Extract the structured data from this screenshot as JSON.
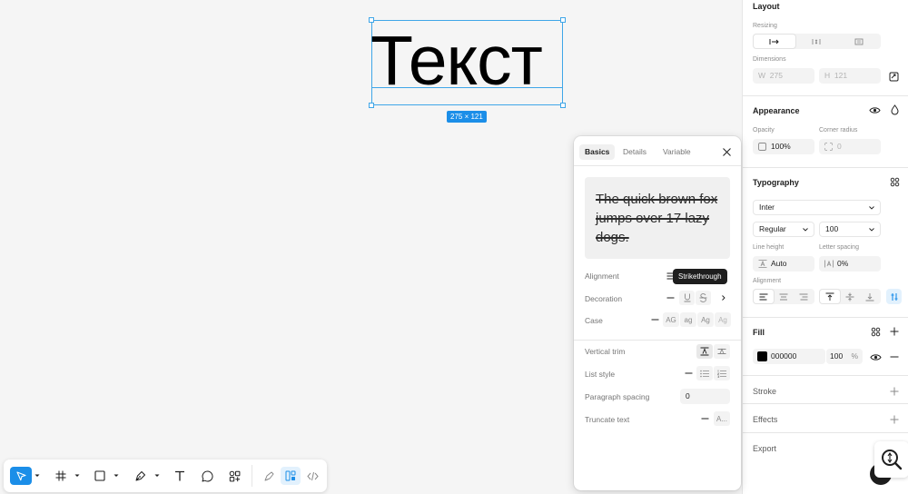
{
  "canvas": {
    "text": "Текст",
    "dimensions_badge": "275 × 121"
  },
  "layout": {
    "title": "Layout",
    "resizing_label": "Resizing",
    "dimensions_label": "Dimensions",
    "width_prefix": "W",
    "width_value": "275",
    "height_prefix": "H",
    "height_value": "121"
  },
  "appearance": {
    "title": "Appearance",
    "opacity_label": "Opacity",
    "opacity_value": "100%",
    "corner_radius_label": "Corner radius",
    "corner_radius_value": "0"
  },
  "typography": {
    "title": "Typography",
    "font_family": "Inter",
    "font_weight": "Regular",
    "font_size": "100",
    "line_height_label": "Line height",
    "line_height_value": "Auto",
    "letter_spacing_label": "Letter spacing",
    "letter_spacing_value": "0%",
    "alignment_label": "Alignment"
  },
  "fill": {
    "title": "Fill",
    "hex": "000000",
    "opacity": "100",
    "opacity_unit": "%",
    "swatch_color": "#000000"
  },
  "stroke": {
    "title": "Stroke"
  },
  "effects": {
    "title": "Effects"
  },
  "export": {
    "title": "Export"
  },
  "popover": {
    "tabs": [
      "Basics",
      "Details",
      "Variable"
    ],
    "active_tab": "Basics",
    "preview_text": "The quick brown fox jumps over 17 lazy dogs.",
    "rows": {
      "alignment": "Alignment",
      "decoration": "Decoration",
      "case": "Case",
      "vertical_trim": "Vertical trim",
      "list_style": "List style",
      "paragraph_spacing": "Paragraph spacing",
      "paragraph_spacing_value": "0",
      "truncate_text": "Truncate text",
      "truncate_value": "A..."
    },
    "case_options": [
      "AG",
      "ag",
      "Ag",
      "Ag"
    ],
    "tooltip": "Strikethrough"
  },
  "colors": {
    "accent": "#1b8ee8",
    "selection": "#3fa6e8"
  }
}
